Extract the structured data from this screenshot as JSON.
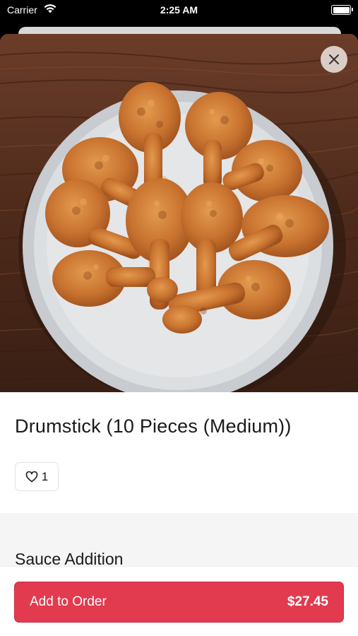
{
  "status_bar": {
    "carrier": "Carrier",
    "time": "2:25 AM",
    "wifi_icon": "wifi-icon",
    "battery_icon": "battery-icon"
  },
  "item": {
    "image_icon": "fried-drumsticks-photo",
    "title": "Drumstick (10 Pieces (Medium))",
    "like_count": "1",
    "like_icon": "heart-icon"
  },
  "close_icon": "close-icon",
  "sections": [
    {
      "title": "Sauce Addition"
    }
  ],
  "footer": {
    "button_label": "Add to Order",
    "price": "$27.45"
  },
  "colors": {
    "accent": "#e23a4f",
    "section_bg": "#f5f5f5"
  }
}
